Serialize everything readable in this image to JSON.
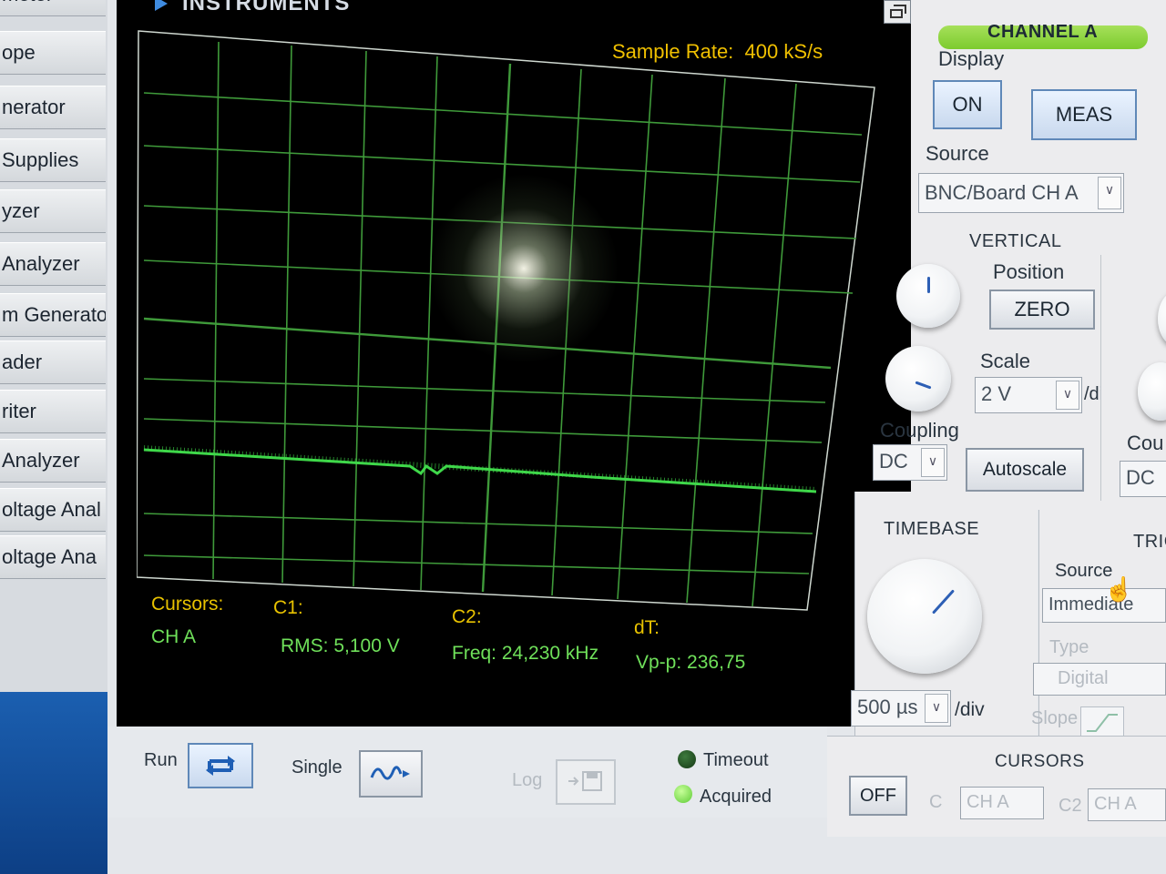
{
  "sidebar": {
    "items": [
      {
        "label": "meter"
      },
      {
        "label": "ope"
      },
      {
        "label": "nerator"
      },
      {
        "label": "Supplies"
      },
      {
        "label": "yzer"
      },
      {
        "label": "Analyzer"
      },
      {
        "label": "m Generato"
      },
      {
        "label": "ader"
      },
      {
        "label": "riter"
      },
      {
        "label": "Analyzer"
      },
      {
        "label": "oltage Anal"
      },
      {
        "label": "oltage Ana"
      }
    ]
  },
  "scope": {
    "brand": "INSTRUMENTS",
    "sample_rate_label": "Sample Rate:",
    "sample_rate_value": "400 kS/s",
    "cursors": {
      "label": "Cursors:",
      "channel": "CH A",
      "c1_label": "C1:",
      "c2_label": "C2:",
      "dt_label": "dT:",
      "rms": "RMS: 5,100 V",
      "freq": "Freq: 24,230 kHz",
      "vpp": "Vp-p: 236,75"
    },
    "trace_color": "#3fd84a",
    "grid_color": "#3f9a3a"
  },
  "channel_a": {
    "title": "CHANNEL A",
    "display_label": "Display",
    "on_button": "ON",
    "meas_button": "MEAS",
    "source_label": "Source",
    "source_value": "BNC/Board CH A",
    "vertical_label": "VERTICAL",
    "position_label": "Position",
    "zero_button": "ZERO",
    "scale_label": "Scale",
    "scale_value": "2 V",
    "scale_unit": "/div",
    "coupling_label": "Coupling",
    "coupling_value": "DC",
    "autoscale_button": "Autoscale",
    "coupling_label_b": "Cou",
    "coupling_value_b": "DC"
  },
  "timebase": {
    "title": "TIMEBASE",
    "value": "500 µs",
    "unit": "/div"
  },
  "trigger": {
    "title": "TRIG",
    "source_label": "Source",
    "source_value": "Immediate",
    "type_label": "Type",
    "type_value": "Digital",
    "slope_label": "Slope"
  },
  "bottom": {
    "run_label": "Run",
    "single_label": "Single",
    "log_label": "Log",
    "timeout_label": "Timeout",
    "acquired_label": "Acquired"
  },
  "cursors_panel": {
    "title": "CURSORS",
    "off_button": "OFF",
    "c1_label": "C",
    "c1_value": "CH A",
    "c2_label": "C2",
    "c2_value": "CH A"
  },
  "colors": {
    "accent_green": "#7ccb2e",
    "led_timeout": "#1f5a1f",
    "led_acquired": "#7de05a"
  }
}
